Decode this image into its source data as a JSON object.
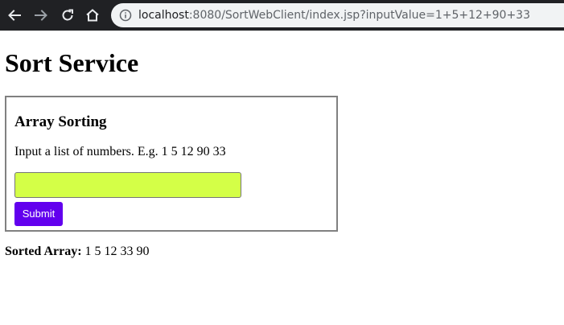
{
  "browser": {
    "url_host": "localhost",
    "url_rest": ":8080/SortWebClient/index.jsp?inputValue=1+5+12+90+33",
    "icons": {
      "back": "arrow-left-icon",
      "forward": "arrow-right-icon",
      "reload": "reload-icon",
      "home": "home-icon",
      "site_info": "info-icon"
    }
  },
  "page": {
    "title": "Sort Service"
  },
  "form": {
    "heading": "Array Sorting",
    "instructions": "Input a list of numbers. E.g. 1 5 12 90 33",
    "input_value": "",
    "input_color": "#d4ff47",
    "submit_label": "Submit",
    "submit_color": "#6200ee"
  },
  "result": {
    "label": "Sorted Array:",
    "value": "1 5 12 33 90"
  }
}
